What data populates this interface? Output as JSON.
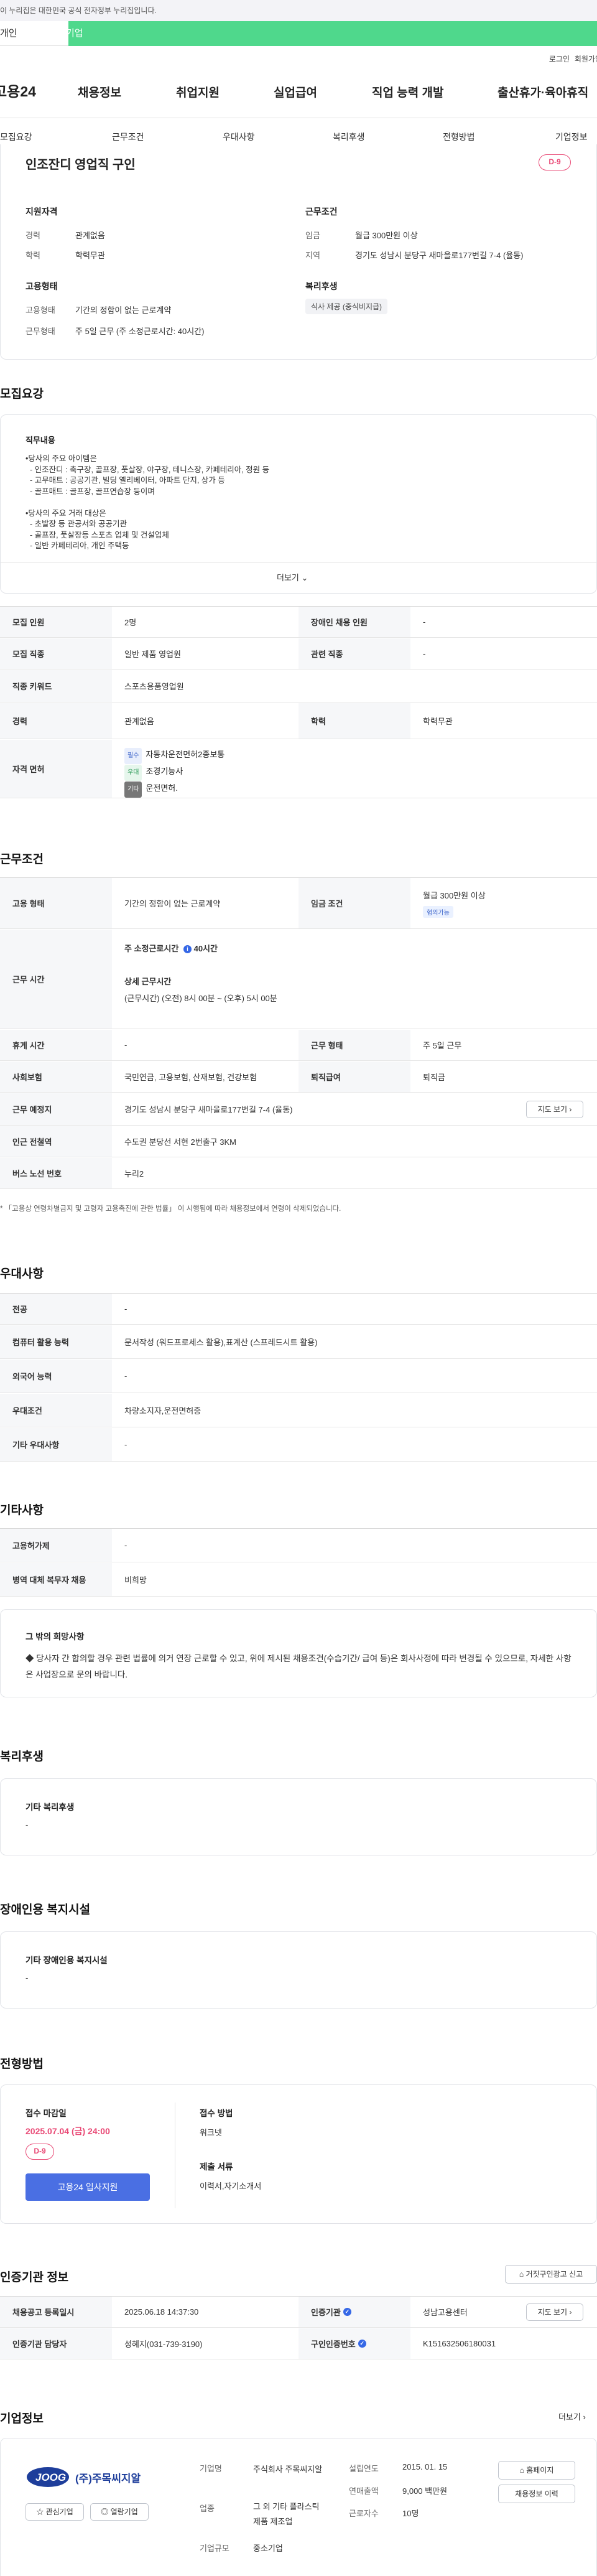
{
  "top": {
    "gov_notice": "이 누리집은 대한민국 공식 전자정부 누리집입니다.",
    "tab_individual": "개인",
    "tab_business": "기업",
    "login": "로그인",
    "join": "회원가입"
  },
  "gnb": {
    "logo": "고용24",
    "menu": [
      "채용정보",
      "취업지원",
      "실업급여",
      "직업 능력 개발",
      "출산휴가·육아휴직"
    ]
  },
  "subnav": [
    "모집요강",
    "근무조건",
    "우대사항",
    "복리후생",
    "전형방법",
    "기업정보"
  ],
  "summary": {
    "title": "인조잔디 영업직 구인",
    "dday": "D-9",
    "qual_title": "지원자격",
    "career_label": "경력",
    "career": "관계없음",
    "edu_label": "학력",
    "edu": "학력무관",
    "cond_title": "근무조건",
    "wage_label": "임금",
    "wage": "월급 300만원 이상",
    "region_label": "지역",
    "region": "경기도 성남시 분당구 새마을로177번길 7-4 (율동)",
    "emp_title": "고용형태",
    "emp_label": "고용형태",
    "emp": "기간의 정함이 없는 근로계약",
    "work_label": "근무형태",
    "work": "주 5일 근무 (주 소정근로시간: 40시간)",
    "welfare_title": "복리후생",
    "welfare_tag": "식사 제공 (중식비지급)"
  },
  "recruit": {
    "title": "모집요강",
    "job_title": "직무내용",
    "lines": [
      "•당사의 주요 아이템은",
      "  - 인조잔디 : 축구장, 골프장, 풋살장, 야구장, 테니스장, 카페테리아, 정원 등",
      "  - 고무매트 : 공공기관, 빌딩 옐리베이터, 아파트 단지, 상가 등",
      "  - 골프매트 : 골프장, 골프연습장 등이며",
      "",
      "•당사의 주요 거래 대상은",
      "  - 초발장 등 관공서와 공공기관",
      "  - 골프장, 풋살장등 스포츠 업체 및 건설업체",
      "  - 일반 카페테리아, 개인 주택등"
    ],
    "more": "더보기",
    "rows": [
      {
        "h": "모집 인원",
        "v": "2명",
        "h2": "장애인 채용 인원",
        "v2": "-"
      },
      {
        "h": "모집 직종",
        "v": "일반 제품 영업원",
        "h2": "관련 직종",
        "v2": "-"
      },
      {
        "h": "직종 키워드",
        "v": "스포츠용품영업원"
      },
      {
        "h": "경력",
        "v": "관계없음",
        "h2": "학력",
        "v2": "학력무관"
      }
    ],
    "license_h": "자격 면허",
    "licenses": [
      {
        "tag": "필수",
        "name": "자동차운전면허2종보통"
      },
      {
        "tag": "우대",
        "name": "조경기능사"
      },
      {
        "tag": "기타",
        "name": "운전면허."
      }
    ]
  },
  "conditions": {
    "title": "근무조건",
    "emp_h": "고용 형태",
    "emp_v": "기간의 정함이 없는 근로계약",
    "wage_h": "임금 조건",
    "wage_v": "월급 300만원 이상",
    "wage_tag": "협의가능",
    "time_h": "근무 시간",
    "weekly": "주 소정근로시간",
    "weekly_v": "40시간",
    "detail": "상세 근무시간",
    "detail_v": "(근무시간) (오전) 8시 00분 ~ (오후) 5시 00분",
    "rest_h": "휴게 시간",
    "rest_v": "-",
    "form_h": "근무 형태",
    "form_v": "주 5일 근무",
    "ins_h": "사회보험",
    "ins_v": "국민연금, 고용보험, 산재보험, 건강보험",
    "sev_h": "퇴직급여",
    "sev_v": "퇴직금",
    "place_h": "근무 예정지",
    "place_v": "경기도 성남시 분당구 새마을로177번길 7-4 (율동)",
    "map_btn": "지도 보기",
    "sub_h": "인근 전철역",
    "sub_v": "수도권 분당선 서현 2번출구 3KM",
    "bus_h": "버스 노선 번호",
    "bus_v": "누리2",
    "note": "* 「고용상 연령차별금지 및 고령자 고용촉진에 관한 법률」 이 시행됨에 따라 채용정보에서 연령이 삭제되었습니다."
  },
  "pref": {
    "title": "우대사항",
    "rows": [
      {
        "h": "전공",
        "v": "-"
      },
      {
        "h": "컴퓨터 활용 능력",
        "v": "문서작성 (워드프로세스 활용),표계산 (스프레드시트 활용)"
      },
      {
        "h": "외국어 능력",
        "v": "-"
      },
      {
        "h": "우대조건",
        "v": "차량소지자,운전면허증"
      },
      {
        "h": "기타 우대사항",
        "v": "-"
      }
    ]
  },
  "etc": {
    "title": "기타사항",
    "rows": [
      {
        "h": "고용허가제",
        "v": "-"
      },
      {
        "h": "병역 대체 복무자 채용",
        "v": "비희망"
      }
    ],
    "box_title": "그 밖의 희망사항",
    "box_text": "◆ 당사자 간 합의할 경우 관련 법률에 의거 연장 근로할 수 있고, 위에 제시된 채용조건(수습기간/ 급여 등)은 회사사정에 따라 변경될 수 있으므로, 자세한 사항은 사업장으로 문의 바랍니다."
  },
  "welfare": {
    "title": "복리후생",
    "sub": "기타 복리후생",
    "val": "-"
  },
  "disabled": {
    "title": "장애인용 복지시설",
    "sub": "기타 장애인용 복지시설",
    "val": "-"
  },
  "selection": {
    "title": "전형방법",
    "deadline_h": "접수 마감일",
    "deadline": "2025.07.04 (금) 24:00",
    "dday": "D-9",
    "apply_btn": "고용24 입사지원",
    "method_h": "접수 방법",
    "method": "워크넷",
    "docs_h": "제출 서류",
    "docs": "이력서,자기소개서"
  },
  "agency": {
    "title": "인증기관 정보",
    "report_btn": "거짓구인광고 신고",
    "reg_h": "채용공고 등록일시",
    "reg_v": "2025.06.18 14:37:30",
    "agency_h": "인증기관",
    "agency_v": "성남고용센터",
    "map_btn": "지도 보기",
    "mgr_h": "인증기관 담당자",
    "mgr_v": "성혜지(031-739-3190)",
    "no_h": "구인인증번호",
    "no_v": "K151632506180031"
  },
  "company": {
    "title": "기업정보",
    "more": "더보기",
    "logo": "(주)주목씨지알",
    "fav_btn": "관심기업",
    "review_btn": "열람기업",
    "type_h": "기업명",
    "type_v": "주식회사 주목씨지알",
    "ind_h": "업종",
    "ind_v": "그 외 기타 플라스틱 제품 제조업",
    "scale_h": "기업규모",
    "scale_v": "중소기업",
    "est_h": "설립연도",
    "est_v": "2015. 01. 15",
    "sales_h": "연매출액",
    "sales_v": "9,000 백만원",
    "emp_h": "근로자수",
    "emp_v": "10명",
    "home_btn": "홈페이지",
    "info_btn": "채용정보 이력"
  },
  "colors": {
    "brand_green": "#4fd88c",
    "accent_pink": "#e94a76",
    "apply_blue": "#4a6fe3"
  }
}
